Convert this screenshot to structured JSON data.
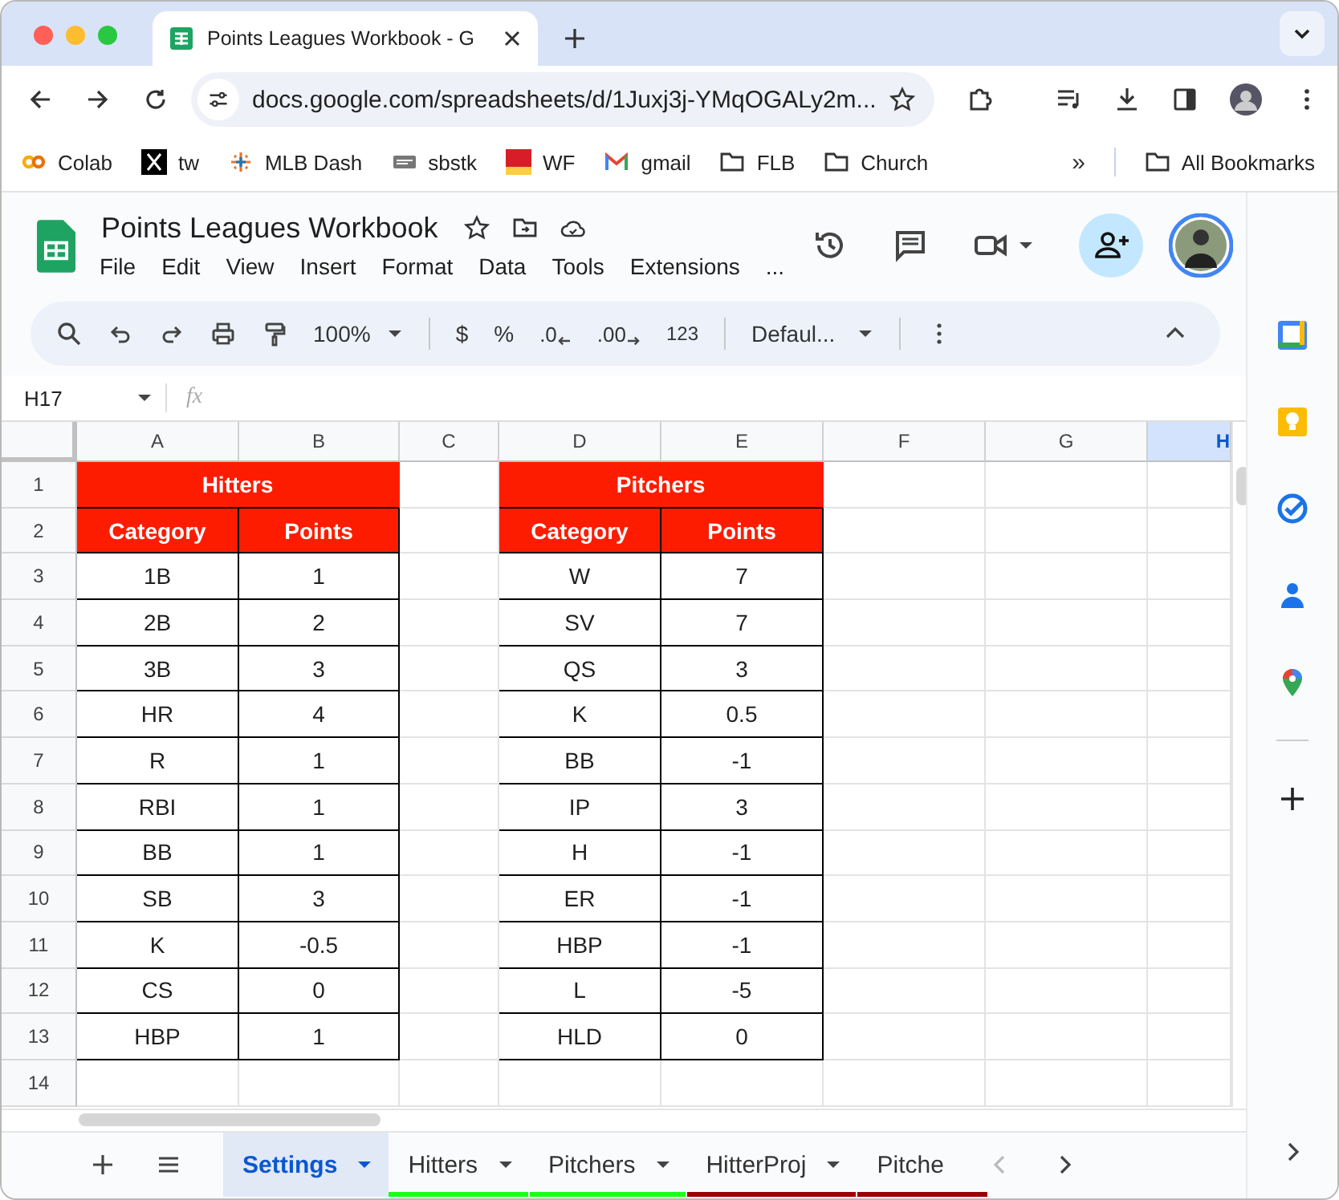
{
  "browser": {
    "tab_title": "Points Leagues Workbook - G",
    "url": "docs.google.com/spreadsheets/d/1Juxj3j-YMqOGALy2m...",
    "bookmarks": [
      {
        "label": "Colab",
        "kind": "colab"
      },
      {
        "label": "tw",
        "kind": "x"
      },
      {
        "label": "MLB Dash",
        "kind": "tableau"
      },
      {
        "label": "sbstk",
        "kind": "site"
      },
      {
        "label": "WF",
        "kind": "wf"
      },
      {
        "label": "gmail",
        "kind": "gmail"
      },
      {
        "label": "FLB",
        "kind": "folder"
      },
      {
        "label": "Church",
        "kind": "folder"
      }
    ],
    "overflow": "»",
    "all_bookmarks": "All Bookmarks"
  },
  "doc": {
    "title": "Points Leagues Workbook",
    "menus": [
      "File",
      "Edit",
      "View",
      "Insert",
      "Format",
      "Data",
      "Tools",
      "Extensions",
      "..."
    ]
  },
  "toolbar": {
    "zoom": "100%",
    "currency": "$",
    "percent": "%",
    "decrease_decimal": ".0",
    "increase_decimal": ".00",
    "number_format": "123",
    "font": "Defaul..."
  },
  "formula_bar": {
    "name_box": "H17",
    "fx": "fx"
  },
  "grid": {
    "columns": [
      {
        "label": "A",
        "selected": false
      },
      {
        "label": "B",
        "selected": false
      },
      {
        "label": "C",
        "selected": false
      },
      {
        "label": "D",
        "selected": false
      },
      {
        "label": "E",
        "selected": false
      },
      {
        "label": "F",
        "selected": false
      },
      {
        "label": "G",
        "selected": false
      },
      {
        "label": "H",
        "selected": true
      }
    ],
    "row_numbers": [
      "1",
      "2",
      "3",
      "4",
      "5",
      "6",
      "7",
      "8",
      "9",
      "10",
      "11",
      "12",
      "13",
      "14"
    ],
    "tables": [
      {
        "title": "Hitters",
        "headers": [
          "Category",
          "Points"
        ],
        "rows": [
          [
            "1B",
            "1"
          ],
          [
            "2B",
            "2"
          ],
          [
            "3B",
            "3"
          ],
          [
            "HR",
            "4"
          ],
          [
            "R",
            "1"
          ],
          [
            "RBI",
            "1"
          ],
          [
            "BB",
            "1"
          ],
          [
            "SB",
            "3"
          ],
          [
            "K",
            "-0.5"
          ],
          [
            "CS",
            "0"
          ],
          [
            "HBP",
            "1"
          ]
        ]
      },
      {
        "title": "Pitchers",
        "headers": [
          "Category",
          "Points"
        ],
        "rows": [
          [
            "W",
            "7"
          ],
          [
            "SV",
            "7"
          ],
          [
            "QS",
            "3"
          ],
          [
            "K",
            "0.5"
          ],
          [
            "BB",
            "-1"
          ],
          [
            "IP",
            "3"
          ],
          [
            "H",
            "-1"
          ],
          [
            "ER",
            "-1"
          ],
          [
            "HBP",
            "-1"
          ],
          [
            "L",
            "-5"
          ],
          [
            "HLD",
            "0"
          ]
        ]
      }
    ]
  },
  "sheet_tabs": [
    {
      "label": "Settings",
      "selected": true
    },
    {
      "label": "Hitters",
      "selected": false,
      "color": "#1aff1a"
    },
    {
      "label": "Pitchers",
      "selected": false,
      "color": "#1aff1a"
    },
    {
      "label": "HitterProj",
      "selected": false,
      "color": "#990000"
    },
    {
      "label": "Pitche",
      "selected": false,
      "color": "#990000"
    }
  ]
}
